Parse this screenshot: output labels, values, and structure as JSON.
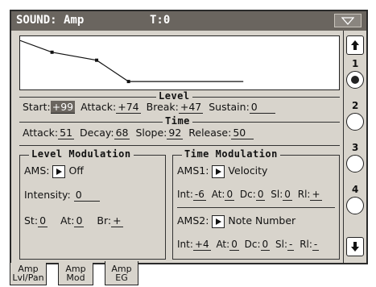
{
  "title": {
    "left": "SOUND: Amp",
    "track": "T:0"
  },
  "graph": {
    "points": [
      [
        0,
        0.08
      ],
      [
        0.1,
        0.3
      ],
      [
        0.24,
        0.45
      ],
      [
        0.34,
        0.85
      ],
      [
        0.7,
        0.85
      ],
      [
        0.7,
        0.85
      ]
    ]
  },
  "level": {
    "title": "Level",
    "start_label": "Start:",
    "start": "+99",
    "attack_label": "Attack:",
    "attack": "+74",
    "break_label": "Break:",
    "break": "+47",
    "sustain_label": "Sustain:",
    "sustain": "0"
  },
  "time": {
    "title": "Time",
    "attack_label": "Attack:",
    "attack": "51",
    "decay_label": "Decay:",
    "decay": "68",
    "slope_label": "Slope:",
    "slope": "92",
    "release_label": "Release:",
    "release": "50"
  },
  "level_mod": {
    "title": "Level Modulation",
    "ams_label": "AMS:",
    "ams_value": "Off",
    "intensity_label": "Intensity:",
    "intensity": "0",
    "st_label": "St:",
    "st": "0",
    "at_label": "At:",
    "at": "0",
    "br_label": "Br:",
    "br": "+"
  },
  "time_mod": {
    "title": "Time Modulation",
    "ams1_label": "AMS1:",
    "ams1_value": "Velocity",
    "r1": {
      "int_label": "Int:",
      "int": "-6",
      "at_label": "At:",
      "at": "0",
      "dc_label": "Dc:",
      "dc": "0",
      "sl_label": "Sl:",
      "sl": "0",
      "rl_label": "Rl:",
      "rl": "+"
    },
    "ams2_label": "AMS2:",
    "ams2_value": "Note Number",
    "r2": {
      "int_label": "Int:",
      "int": "+4",
      "at_label": "At:",
      "at": "0",
      "dc_label": "Dc:",
      "dc": "0",
      "sl_label": "Sl:",
      "sl": "-",
      "rl_label": "Rl:",
      "rl": "-"
    }
  },
  "sidebar": {
    "numbers": [
      "1",
      "2",
      "3",
      "4"
    ],
    "selected": 1
  },
  "tabs": [
    {
      "line1": "Amp",
      "line2": "Lvl/Pan"
    },
    {
      "line1": "Amp",
      "line2": "Mod"
    },
    {
      "line1": "Amp",
      "line2": "EG"
    }
  ]
}
